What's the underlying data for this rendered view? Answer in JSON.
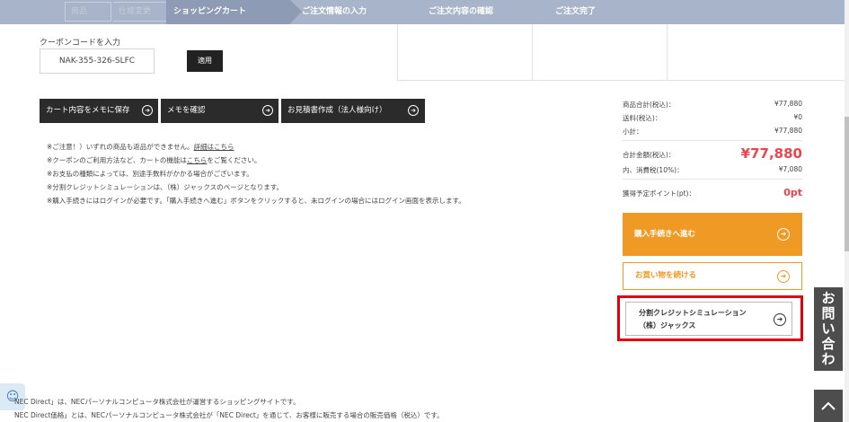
{
  "steps": {
    "hidden_left": [
      "商品",
      "仕様変更"
    ],
    "items": [
      {
        "label": "ショッピングカート",
        "current": true
      },
      {
        "label": "ご注文情報の入力",
        "current": false
      },
      {
        "label": "ご注文内容の確認",
        "current": false
      },
      {
        "label": "ご注文完了",
        "current": false
      }
    ]
  },
  "coupon": {
    "label": "クーポンコードを入力",
    "value": "NAK-355-326-SLFC",
    "apply_label": "適用"
  },
  "memo_buttons": [
    {
      "label": "カート内容をメモに保存"
    },
    {
      "label": "メモを確認"
    },
    {
      "label": "お見積書作成（法人様向け）"
    }
  ],
  "notes": {
    "line1_prefix": "※ご注意！）いずれの商品も返品ができません。",
    "line1_link": "詳細はこちら",
    "line2_prefix": "※クーポンのご利用方法など、カートの機能は",
    "line2_link": "こちら",
    "line2_suffix": "をご覧ください。",
    "line3": "※お支払の種類によっては、別途手数料がかかる場合がございます。",
    "line4": "※分割クレジットシミュレーションは、（株）ジャックスのページとなります。",
    "line5": "※購入手続きにはログインが必要です。「購入手続きへ進む」ボタンをクリックすると、未ログインの場合にはログイン画面を表示します。"
  },
  "summary": {
    "subtotal_goods_label": "商品合計(税込)：",
    "subtotal_goods_value": "¥77,880",
    "shipping_label": "送料(税込)：",
    "shipping_value": "¥0",
    "subtotal_label": "小計：",
    "subtotal_value": "¥77,880",
    "total_label": "合計金額(税込)：",
    "total_value": "¥77,880",
    "tax_label": "内、消費税(10%)：",
    "tax_value": "¥7,080",
    "points_label": "獲得予定ポイント(pt)：",
    "points_value": "0pt"
  },
  "actions": {
    "checkout_label": "購入手続きへ進む",
    "continue_label": "お買い物を続ける",
    "sim_line1": "分割クレジットシミュレーション",
    "sim_line2": "（株）ジャックス"
  },
  "contact_tab": {
    "chars": [
      "お",
      "問",
      "い",
      "合",
      "わ",
      "せ"
    ]
  },
  "footer": {
    "line1": "NEC Direct」は、NECパーソナルコンピュータ株式会社が運営するショッピングサイトです。",
    "line2": "NEC Direct価格」とは、NECパーソナルコンピュータ株式会社が「NEC Direct」を通じて、お客様に販売する場合の販売価格（税込）です。"
  },
  "colors": {
    "accent_orange": "#f09a26",
    "price_red": "#e8454f",
    "highlight_red": "#e00010",
    "step_bar": "#a7b4c9"
  },
  "icons": {
    "arrow": "circle-arrow-right-icon",
    "chat": "smiley-icon",
    "top": "chevron-up-icon"
  }
}
